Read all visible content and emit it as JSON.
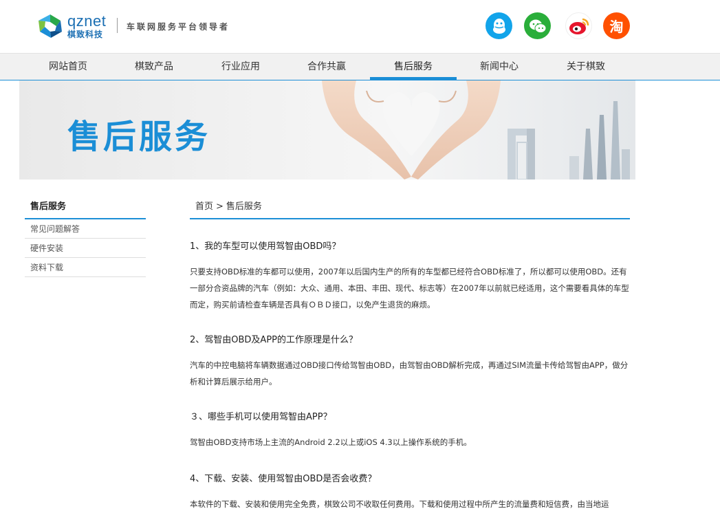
{
  "header": {
    "logo_name": "qznet",
    "logo_sub": "棋致科技",
    "slogan": "车联网服务平台领导者",
    "social": {
      "qq": "qq-icon",
      "wechat": "wechat-icon",
      "weibo": "weibo-icon",
      "taobao_label": "淘"
    }
  },
  "nav": {
    "items": [
      "网站首页",
      "棋致产品",
      "行业应用",
      "合作共赢",
      "售后服务",
      "新闻中心",
      "关于棋致"
    ],
    "active_index": 4
  },
  "banner": {
    "title": "售后服务"
  },
  "sidebar": {
    "title": "售后服务",
    "items": [
      "常见问题解答",
      "硬件安装",
      "资料下载"
    ]
  },
  "breadcrumb": {
    "home": "首页",
    "separator": ">",
    "current": "售后服务"
  },
  "faq": [
    {
      "q": "1、我的车型可以使用驾智由OBD吗？",
      "a": "只要支持OBD标准的车都可以使用，2007年以后国内生产的所有的车型都已经符合OBD标准了，所以都可以使用OBD。还有一部分合资品牌的汽车（例如：大众、通用、本田、丰田、现代、标志等）在2007年以前就已经适用，这个需要看具体的车型而定，购买前请检查车辆是否具有ＯＢＤ接口，以免产生退货的麻烦。"
    },
    {
      "q": "2、驾智由OBD及APP的工作原理是什么？",
      "a": "汽车的中控电脑将车辆数据通过OBD接口传给驾智由OBD，由驾智由OBD解析完成，再通过SIM流量卡传给驾智由APP，做分析和计算后展示给用户。"
    },
    {
      "q": "３、哪些手机可以使用驾智由APP？",
      "a": "驾智由OBD支持市场上主流的Android 2.2以上或iOS 4.3以上操作系统的手机。"
    },
    {
      "q": "4、下载、安装、使用驾智由OBD是否会收费？",
      "a": "本软件的下载、安装和使用完全免费，棋致公司不收取任何费用。下载和使用过程中所产生的流量费和短信费，由当地运"
    }
  ],
  "colors": {
    "accent": "#1b8ed6",
    "nav_bg": "#f1f1f1"
  }
}
